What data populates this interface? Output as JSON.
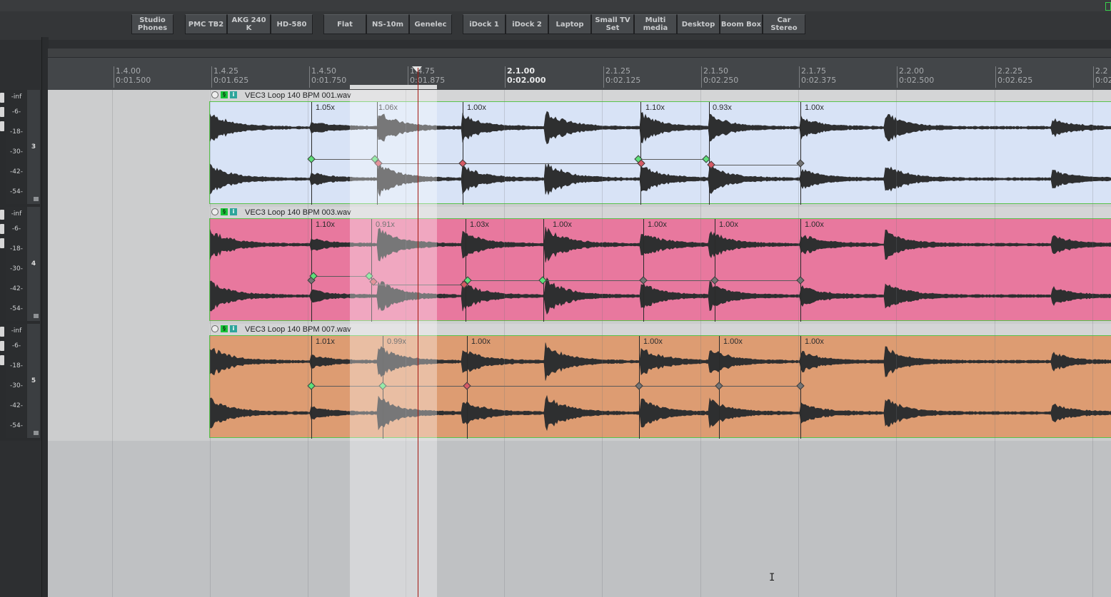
{
  "toolbar": {
    "buttons": [
      {
        "label": "Studio\nPhones"
      },
      {
        "label": "PMC TB2"
      },
      {
        "label": "AKG 240 K"
      },
      {
        "label": "HD-580"
      },
      {
        "label": "Flat"
      },
      {
        "label": "NS-10m"
      },
      {
        "label": "Genelec"
      },
      {
        "label": "iDock 1"
      },
      {
        "label": "iDock 2"
      },
      {
        "label": "Laptop"
      },
      {
        "label": "Small TV\nSet"
      },
      {
        "label": "Multi\nmedia"
      },
      {
        "label": "Desktop"
      },
      {
        "label": "Boom Box"
      },
      {
        "label": "Car Stereo"
      }
    ]
  },
  "ruler": {
    "ticks": [
      {
        "beat": "1.4.00",
        "time": "0:01.500"
      },
      {
        "beat": "1.4.25",
        "time": "0:01.625"
      },
      {
        "beat": "1.4.50",
        "time": "0:01.750"
      },
      {
        "beat": "1.4.75",
        "time": "0:01.875"
      },
      {
        "beat": "2.1.00",
        "time": "0:02.000"
      },
      {
        "beat": "2.1.25",
        "time": "0:02.125"
      },
      {
        "beat": "2.1.50",
        "time": "0:02.250"
      },
      {
        "beat": "2.1.75",
        "time": "0:02.375"
      },
      {
        "beat": "2.2.00",
        "time": "0:02.500"
      },
      {
        "beat": "2.2.25",
        "time": "0:02.625"
      },
      {
        "beat": "2.2",
        "time": "0:02"
      }
    ]
  },
  "meter_scale": [
    "-inf",
    "-6-",
    "-18-",
    "-30-",
    "-42-",
    "-54-"
  ],
  "tracks": [
    {
      "number": "3",
      "item_name": "VEC3 Loop 140 BPM 001.wav",
      "color": "#d8e3f6",
      "rates": [
        "1.05x",
        "1.06x",
        "1.00x",
        "1.10x",
        "0.93x",
        "1.00x"
      ]
    },
    {
      "number": "4",
      "item_name": "VEC3 Loop 140 BPM 003.wav",
      "color": "#e8789e",
      "rates": [
        "1.10x",
        "0.91x",
        "1.03x",
        "1.00x",
        "1.00x",
        "1.00x",
        "1.00x"
      ]
    },
    {
      "number": "5",
      "item_name": "VEC3 Loop 140 BPM 007.wav",
      "color": "#dd9c72",
      "rates": [
        "1.01x",
        "0.99x",
        "1.00x",
        "1.00x",
        "1.00x",
        "1.00x"
      ]
    }
  ],
  "cursor_glyph": "I"
}
